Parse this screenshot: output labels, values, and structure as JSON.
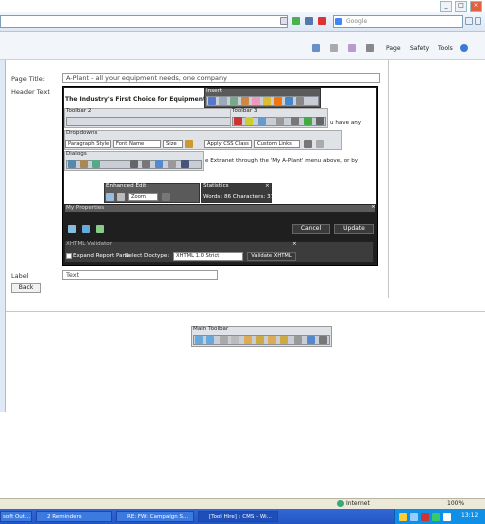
{
  "browser": {
    "search_placeholder": "Google",
    "commands": {
      "page": "Page",
      "safety": "Safety",
      "tools": "Tools"
    }
  },
  "form": {
    "page_title_label": "Page Title:",
    "page_title_value": "A-Plant - all your equipment needs, one company",
    "header_text_label": "Header Text",
    "label_label": "Label",
    "label_value": "Text",
    "back_button": "Back"
  },
  "editor": {
    "content_heading": "The Industry's First Choice for Equipment Rental",
    "content_line_1": "u have any",
    "content_line_2": "e Extranet through the 'My A-Plant' menu above, or by",
    "panels": {
      "insert": "Insert",
      "toolbar2": "Toolbar 2",
      "toolbar3": "Toolbar 3",
      "dropdowns": "Dropdowns",
      "dialogs": "Dialogs",
      "enhanced_edit": "Enhanced Edit",
      "statistics": "Statistics",
      "xhtml_validator": "XHTML Validator",
      "main_toolbar": "Main Toolbar"
    },
    "dropdowns": {
      "paragraph_style": "Paragraph Style",
      "font_name": "Font Name",
      "size": "Size",
      "apply_css": "Apply CSS Class",
      "custom_links": "Custom Links",
      "zoom": "Zoom"
    },
    "word_count": "Words: 86 Characters: 370",
    "bottom_strip_label": "My Properties",
    "cancel_button": "Cancel",
    "update_button": "Update",
    "expand_report": "Expand Report Pane",
    "select_doctype": "Select Doctype:",
    "doctype_value": "XHTML 1.0 Strict",
    "validate_button": "Validate XHTML"
  },
  "status": {
    "zone": "Internet",
    "zoom": "100%"
  },
  "taskbar": {
    "items": [
      "soft Out...",
      "2 Reminders",
      "RE: FW: Campaign S...",
      "[Tool Hire] : CMS - Wi..."
    ],
    "clock": "13:12"
  },
  "colors": {
    "taskbar": "#2356c4",
    "editor_dark": "#1f1f1f",
    "panel": "#5a5a5a"
  }
}
